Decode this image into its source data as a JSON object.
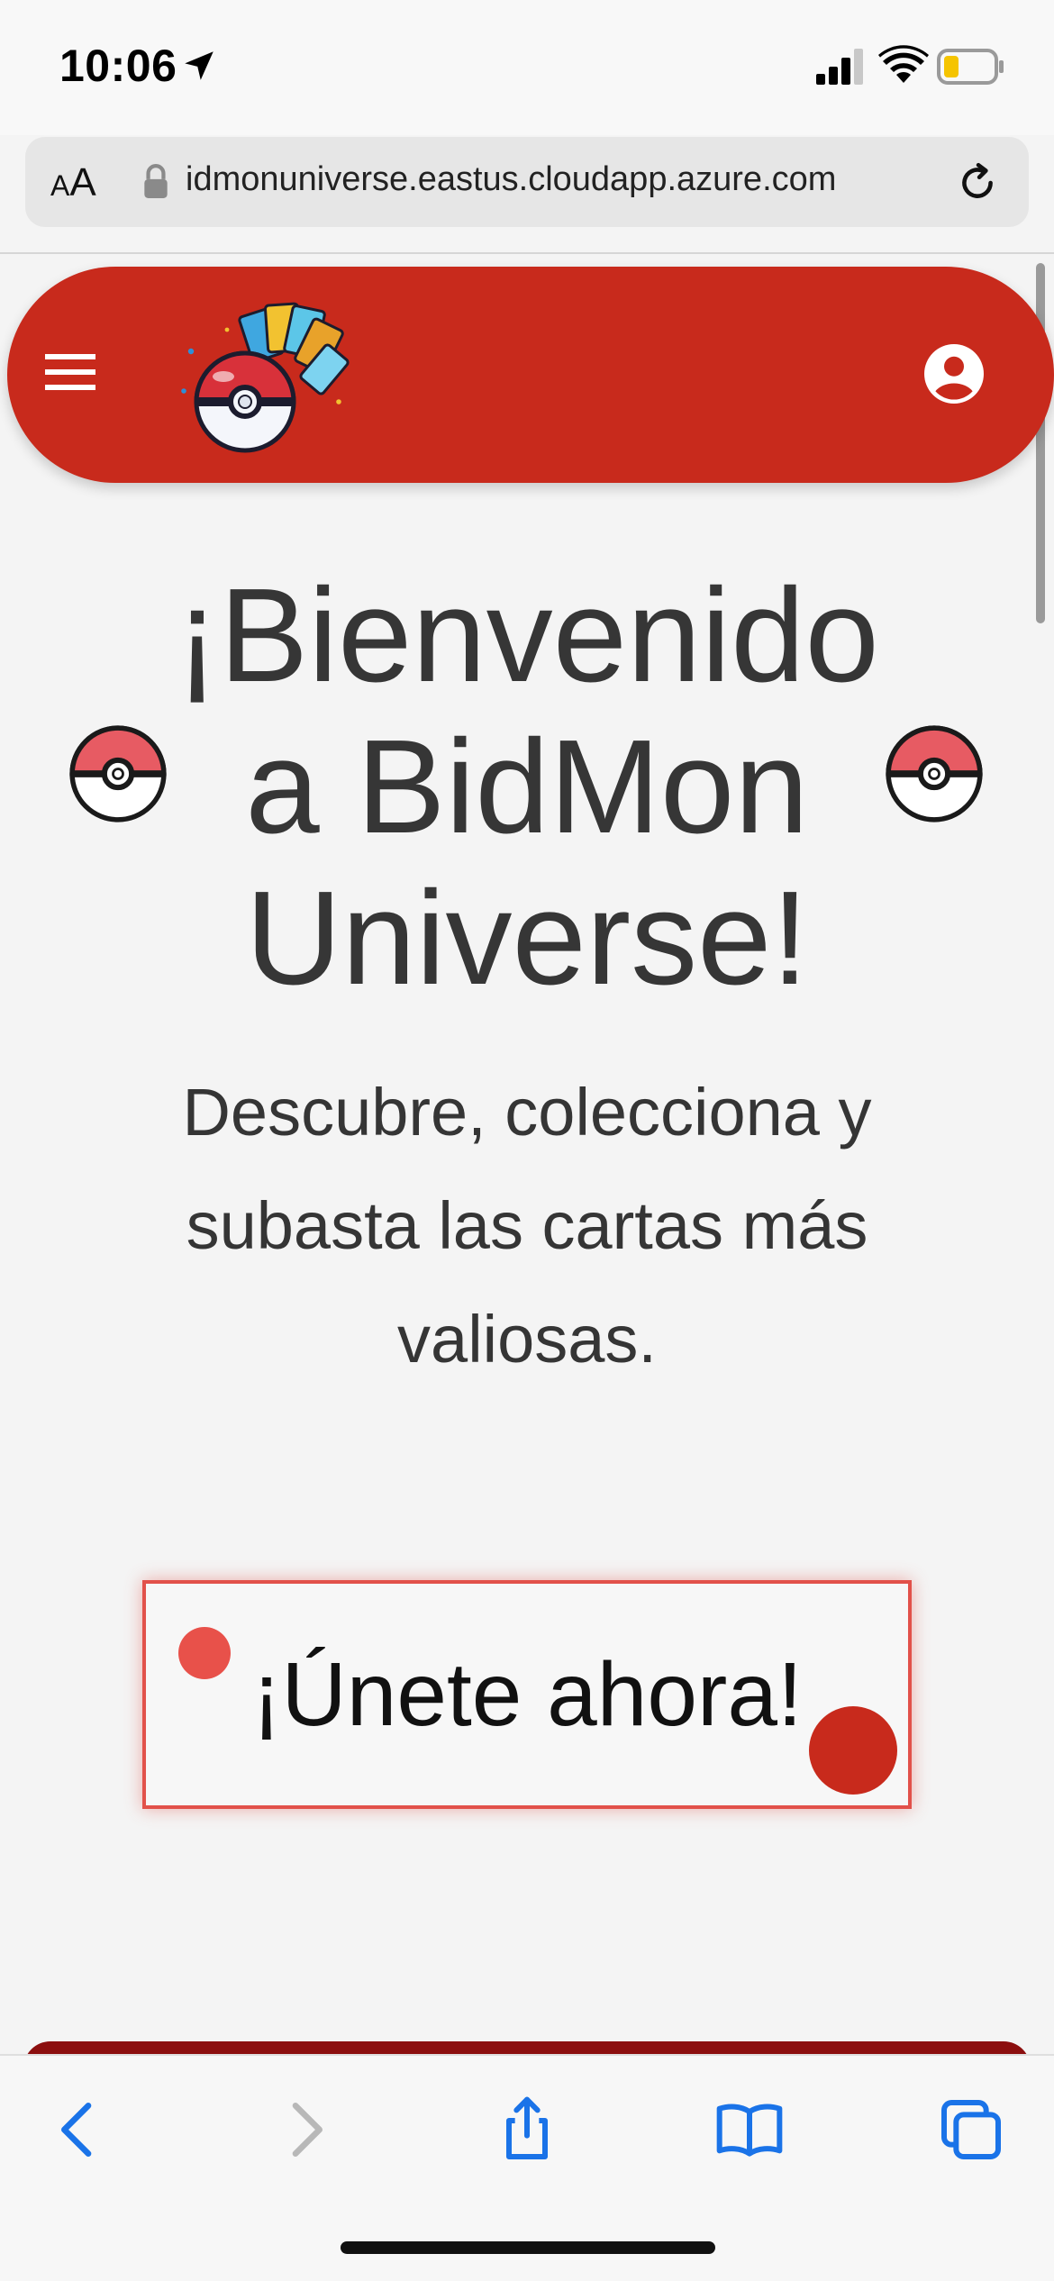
{
  "status_bar": {
    "time": "10:06",
    "icons": [
      "location-arrow-icon",
      "cellular-signal-icon",
      "wifi-icon",
      "battery-low-icon"
    ]
  },
  "address_bar": {
    "text_size_label_small": "A",
    "text_size_label_large": "A",
    "url": "idmonuniverse.eastus.cloudapp.azure.com",
    "icons": [
      "lock-icon",
      "reload-icon"
    ]
  },
  "navbar": {
    "color": "#c82a1c",
    "icons": [
      "hamburger-menu-icon",
      "pokeball-cards-logo",
      "user-account-icon"
    ]
  },
  "hero": {
    "title": "¡Bienvenido a BidMon Universe!",
    "subtitle": "Descubre, colecciona y subasta las cartas más valiosas.",
    "decorations": [
      "pokeball-icon",
      "pokeball-icon"
    ]
  },
  "cta": {
    "label": "¡Únete ahora!",
    "border_color": "#e2514a"
  },
  "toolbar": {
    "icons": [
      "back-icon",
      "forward-icon",
      "share-icon",
      "bookmarks-icon",
      "tabs-icon"
    ],
    "accent": "#1a73e8"
  }
}
